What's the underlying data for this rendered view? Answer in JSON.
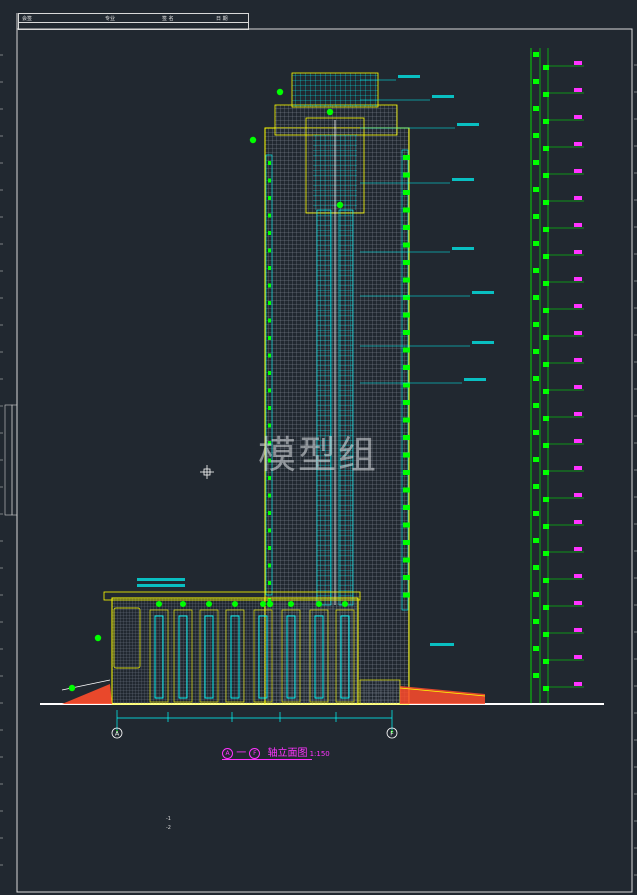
{
  "title_block": {
    "row1": [
      "会签",
      "专业",
      "签 名",
      "日 期"
    ],
    "row2": [
      "",
      "",
      "",
      ""
    ]
  },
  "watermark": "模型组",
  "drawing_title": {
    "axis_start": "A",
    "dash": "一",
    "axis_end": "F",
    "name": "轴立面图",
    "scale": "1:150"
  },
  "axis_labels": [
    "A",
    "F"
  ],
  "bottom_notes": [
    "-1",
    "-2"
  ],
  "colors": {
    "background": "#212830",
    "frame": "#d9d9d9",
    "building_outline": "#ffff00",
    "glazing": "#00ffff",
    "annotation": "#00ff00",
    "title": "#ff33ff",
    "mesh": "#8c94a0",
    "stair": "#ff4b2b"
  }
}
